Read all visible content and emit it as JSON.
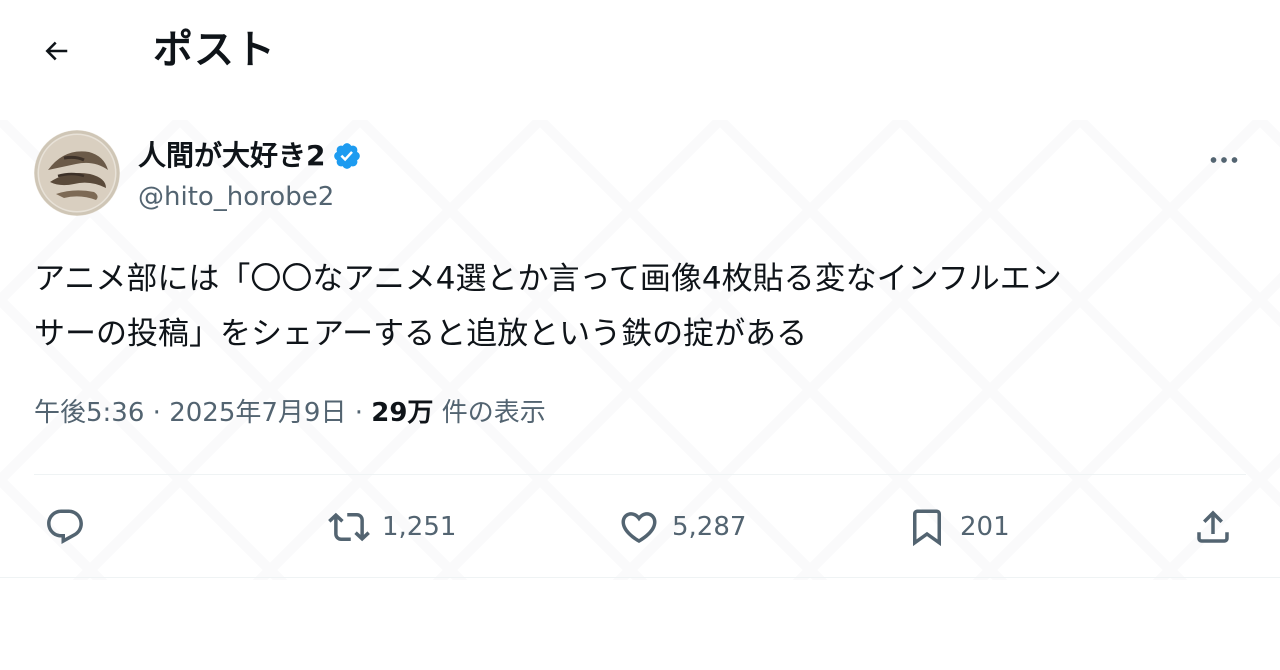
{
  "header": {
    "title": "ポスト",
    "back_icon": "arrow-left-icon"
  },
  "author": {
    "display_name": "人間が大好き2",
    "handle": "@hito_horobe2",
    "verified": true,
    "verified_color": "#1d9bf0",
    "more_icon": "more-horizontal-icon"
  },
  "tweet": {
    "text_lines": [
      "アニメ部には「〇〇なアニメ4選とか言って画像4枚貼る変なインフルエン",
      "サーの投稿」をシェアーすると追放という鉄の掟がある"
    ]
  },
  "meta": {
    "time": "午後5:36",
    "separator": "·",
    "date": "2025年7月9日",
    "views_count": "29万",
    "views_label": "件の表示"
  },
  "actions": {
    "reply": {
      "icon": "reply-icon",
      "count": ""
    },
    "repost": {
      "icon": "repost-icon",
      "count": "1,251"
    },
    "like": {
      "icon": "heart-icon",
      "count": "5,287"
    },
    "bookmark": {
      "icon": "bookmark-icon",
      "count": "201"
    },
    "share": {
      "icon": "share-icon"
    }
  },
  "colors": {
    "text": "#0f1419",
    "secondary": "#536471",
    "accent": "#1d9bf0"
  }
}
